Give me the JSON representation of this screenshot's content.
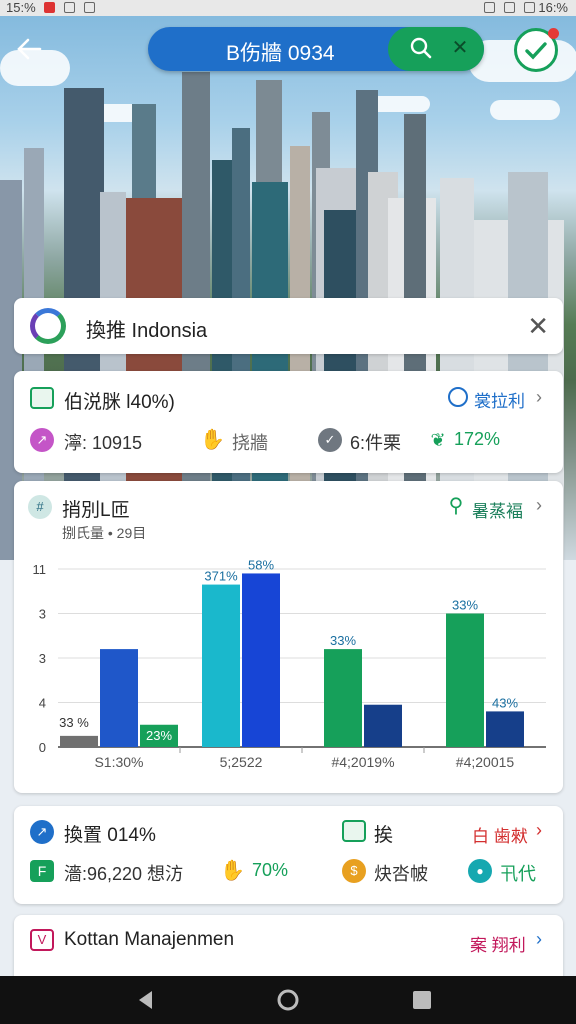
{
  "status_bar": {
    "time": "15:%",
    "right": "16:%"
  },
  "search": {
    "query": "B伤牆 0934"
  },
  "location": {
    "text": "換推 Indonsia"
  },
  "card1": {
    "title": "伯涚脒 l40%)",
    "link": "裳拉利",
    "stats": [
      {
        "label": "濘: 10915",
        "icon": "route-icon"
      },
      {
        "label": "挠牆",
        "icon": "hand-icon"
      },
      {
        "label": "6:件栗",
        "icon": "check-icon"
      },
      {
        "label": "172%",
        "icon": "leaf-icon"
      }
    ]
  },
  "card2": {
    "title": "捎別L匝",
    "subtitle": "捌氏量 • 29目",
    "link": "暑蒸褔",
    "chart_data": {
      "type": "bar",
      "y_ticks": [
        "0",
        "4",
        "3",
        "3",
        "11"
      ],
      "categories": [
        "S1:30%",
        "5;2522",
        "#4;2019%",
        "#4;20015"
      ],
      "groups": [
        {
          "bars": [
            {
              "value": 0.5,
              "color": "#707070"
            },
            {
              "value": 4.4,
              "color": "#1f57c9",
              "label": ""
            },
            {
              "value": 1.0,
              "color": "#16a05a",
              "label": "23%"
            }
          ],
          "top_label": "33 %"
        },
        {
          "bars": [
            {
              "value": 7.3,
              "color": "#1ab8cc",
              "label": "371%"
            },
            {
              "value": 7.8,
              "color": "#1745d6",
              "label": "58%"
            }
          ]
        },
        {
          "bars": [
            {
              "value": 4.4,
              "color": "#16a05a",
              "label": "33%"
            },
            {
              "value": 1.9,
              "color": "#163f8a",
              "label": ""
            }
          ]
        },
        {
          "bars": [
            {
              "value": 6.0,
              "color": "#16a05a",
              "label": "33%"
            },
            {
              "value": 1.6,
              "color": "#163f8a",
              "label": "43%"
            }
          ]
        }
      ]
    }
  },
  "card3": {
    "title": "換置 014%",
    "mid_label": "挨",
    "link": "白 歯猌",
    "stats": [
      {
        "label": "濇:96,220 想汸",
        "icon": "f-icon"
      },
      {
        "label": "70%",
        "icon": "hand-icon"
      },
      {
        "label": "炔呇帔",
        "icon": "coin-icon"
      },
      {
        "label": "卂代",
        "icon": "globe-icon"
      }
    ]
  },
  "card4": {
    "title": "Kottan Manajenmen",
    "link": "案 翔利"
  },
  "colors": {
    "brand_blue": "#1f6fc9",
    "brand_green": "#16a05a",
    "accent_red": "#e53935"
  }
}
